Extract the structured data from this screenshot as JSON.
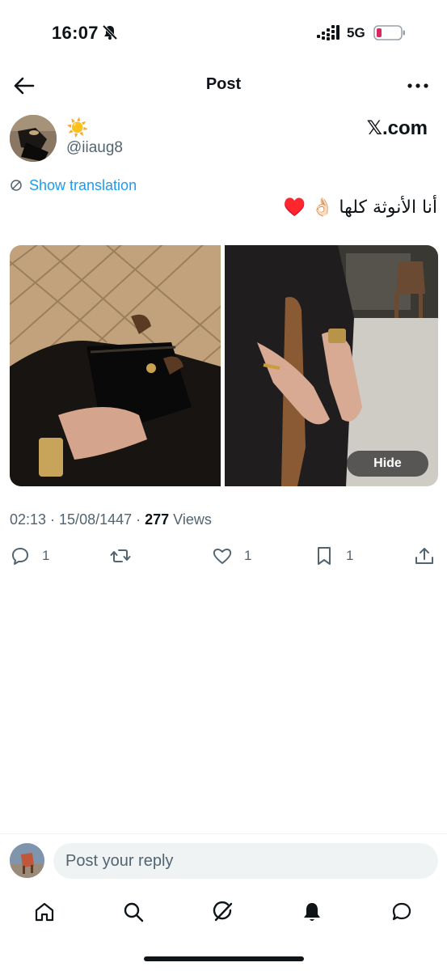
{
  "status": {
    "time": "16:07",
    "network": "5G"
  },
  "header": {
    "title": "Post"
  },
  "author": {
    "emoji": "☀️",
    "handle": "@iiaug8",
    "source": "𝕏.com"
  },
  "translation": {
    "label": "Show translation"
  },
  "tweet": {
    "text": "أنا الأنوثة كلها 👌🏻 ♥️"
  },
  "media": {
    "hide_label": "Hide"
  },
  "meta": {
    "time_date": "02:13 · 15/08/1447 · ",
    "views_count": "277",
    "views_label": " Views"
  },
  "actions": {
    "replies": "1",
    "likes": "1",
    "bookmarks": "1"
  },
  "reply": {
    "placeholder": "Post your reply"
  },
  "colors": {
    "accent": "#1d9bf0",
    "text": "#0f1419",
    "secondary": "#536471"
  }
}
